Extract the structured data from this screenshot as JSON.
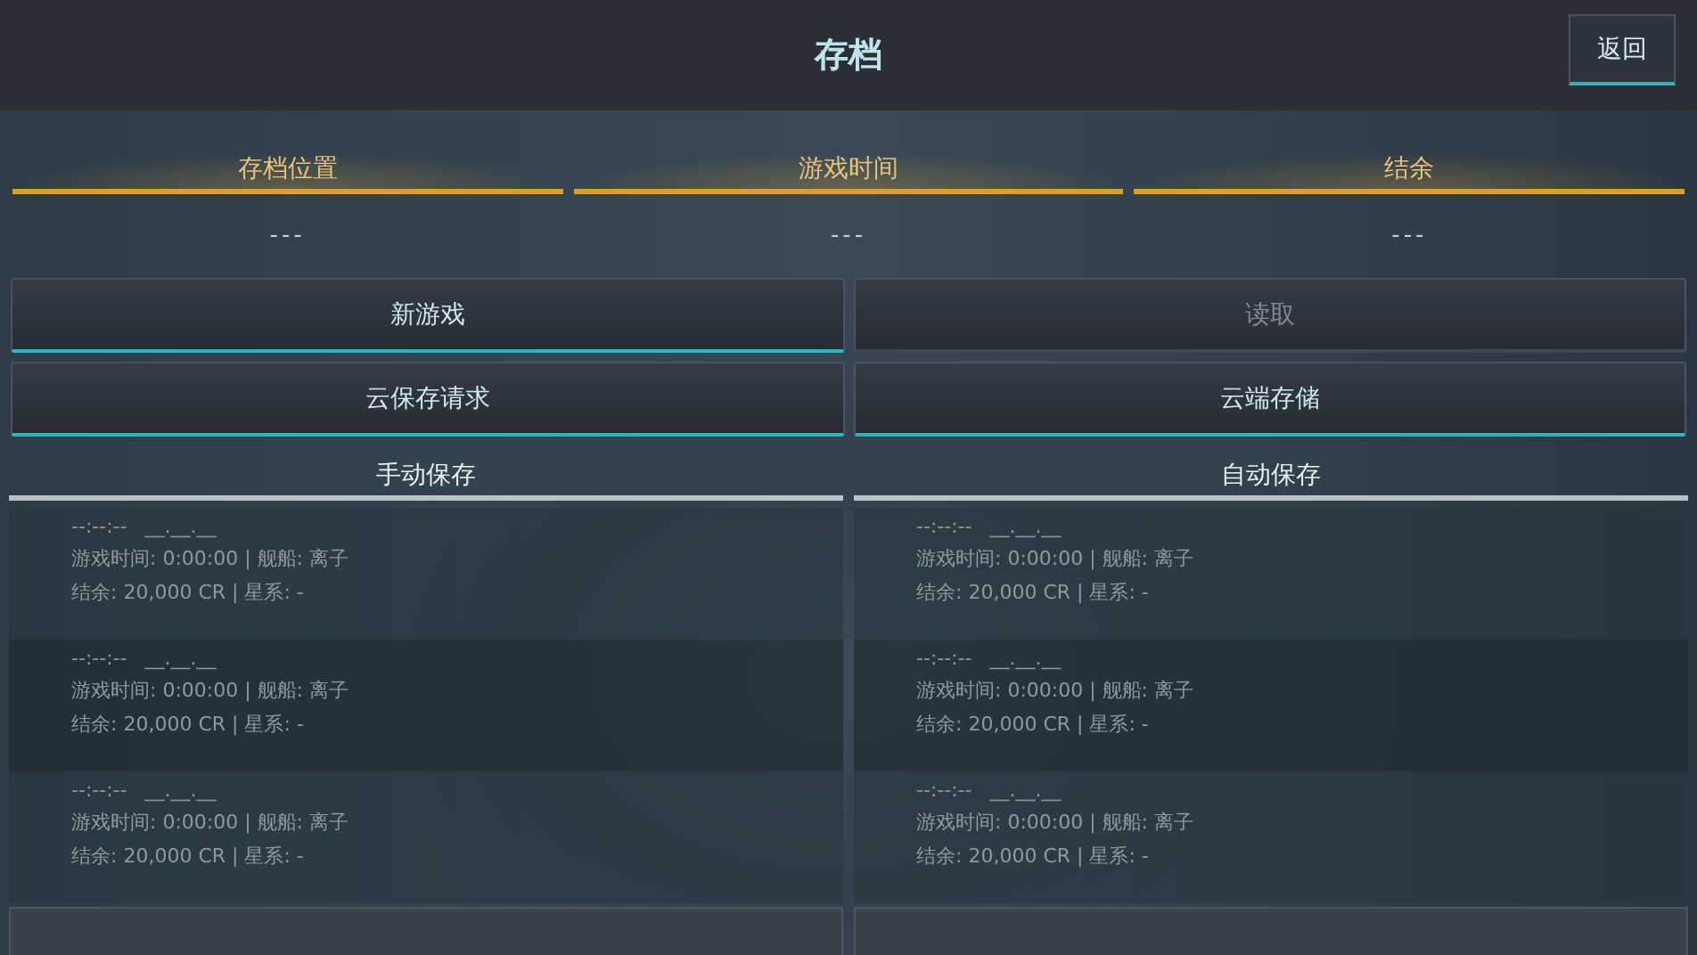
{
  "header": {
    "title": "存档",
    "back_button": "返回"
  },
  "summary": [
    {
      "label": "存档位置",
      "value": "---"
    },
    {
      "label": "游戏时间",
      "value": "---"
    },
    {
      "label": "结余",
      "value": "---"
    }
  ],
  "buttons": [
    {
      "label": "新游戏",
      "disabled": false
    },
    {
      "label": "读取",
      "disabled": true
    },
    {
      "label": "云保存请求",
      "disabled": false
    },
    {
      "label": "云端存储",
      "disabled": false
    }
  ],
  "sections": [
    {
      "title": "手动保存",
      "slots": [
        {
          "time": "--:--:--",
          "date": "__.__.__",
          "line_1": "游戏时间: 0:00:00 | 舰船: 离子",
          "line_2": "结余: 20,000 CR | 星系: -"
        },
        {
          "time": "--:--:--",
          "date": "__.__.__",
          "line_1": "游戏时间: 0:00:00 | 舰船: 离子",
          "line_2": "结余: 20,000 CR | 星系: -"
        },
        {
          "time": "--:--:--",
          "date": "__.__.__",
          "line_1": "游戏时间: 0:00:00 | 舰船: 离子",
          "line_2": "结余: 20,000 CR | 星系: -"
        }
      ]
    },
    {
      "title": "自动保存",
      "slots": [
        {
          "time": "--:--:--",
          "date": "__.__.__",
          "line_1": "游戏时间: 0:00:00 | 舰船: 离子",
          "line_2": "结余: 20,000 CR | 星系: -"
        },
        {
          "time": "--:--:--",
          "date": "__.__.__",
          "line_1": "游戏时间: 0:00:00 | 舰船: 离子",
          "line_2": "结余: 20,000 CR | 星系: -"
        },
        {
          "time": "--:--:--",
          "date": "__.__.__",
          "line_1": "游戏时间: 0:00:00 | 舰船: 离子",
          "line_2": "结余: 20,000 CR | 星系: -"
        }
      ]
    }
  ]
}
